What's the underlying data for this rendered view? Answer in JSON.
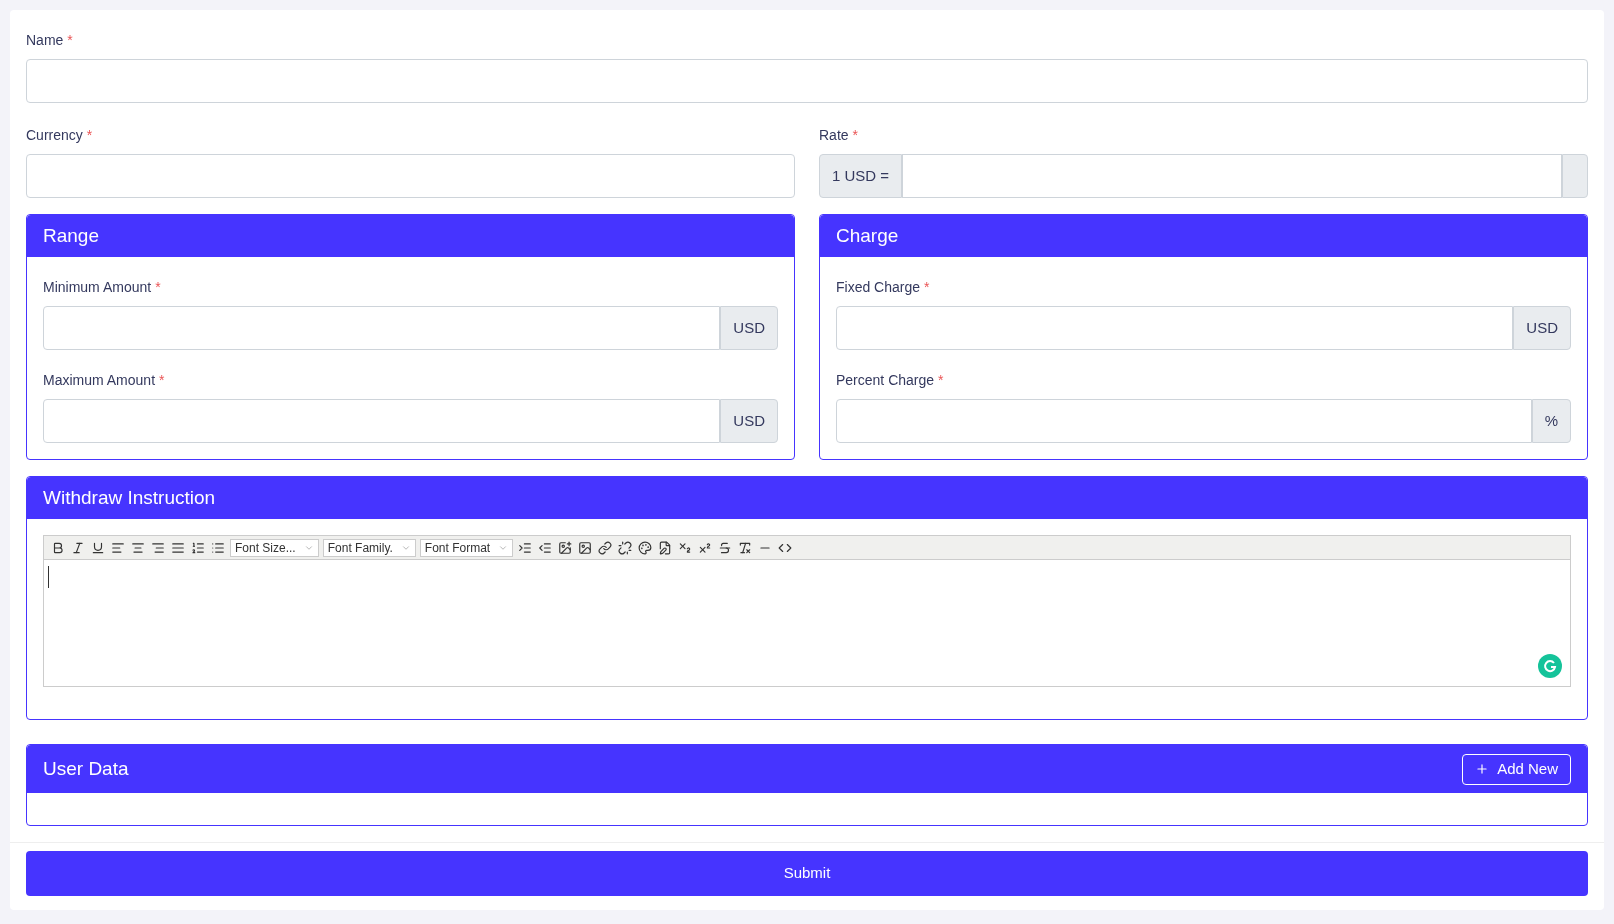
{
  "required_mark": "*",
  "name_field": {
    "label": "Name",
    "required": true
  },
  "currency_field": {
    "label": "Currency",
    "required": true
  },
  "rate_field": {
    "label": "Rate",
    "required": true,
    "prefix": "1 USD ="
  },
  "sections": [
    {
      "title": "Range",
      "fields": [
        {
          "label": "Minimum Amount",
          "required": true,
          "suffix": "USD"
        },
        {
          "label": "Maximum Amount",
          "required": true,
          "suffix": "USD"
        }
      ]
    },
    {
      "title": "Charge",
      "fields": [
        {
          "label": "Fixed Charge",
          "required": true,
          "suffix": "USD"
        },
        {
          "label": "Percent Charge",
          "required": true,
          "suffix": "%"
        }
      ]
    }
  ],
  "instruction": {
    "title": "Withdraw Instruction",
    "dropdowns": [
      "Font Size...",
      "Font Family.",
      "Font Format"
    ]
  },
  "user_data": {
    "title": "User Data",
    "add_button": "Add New"
  },
  "submit": "Submit"
}
